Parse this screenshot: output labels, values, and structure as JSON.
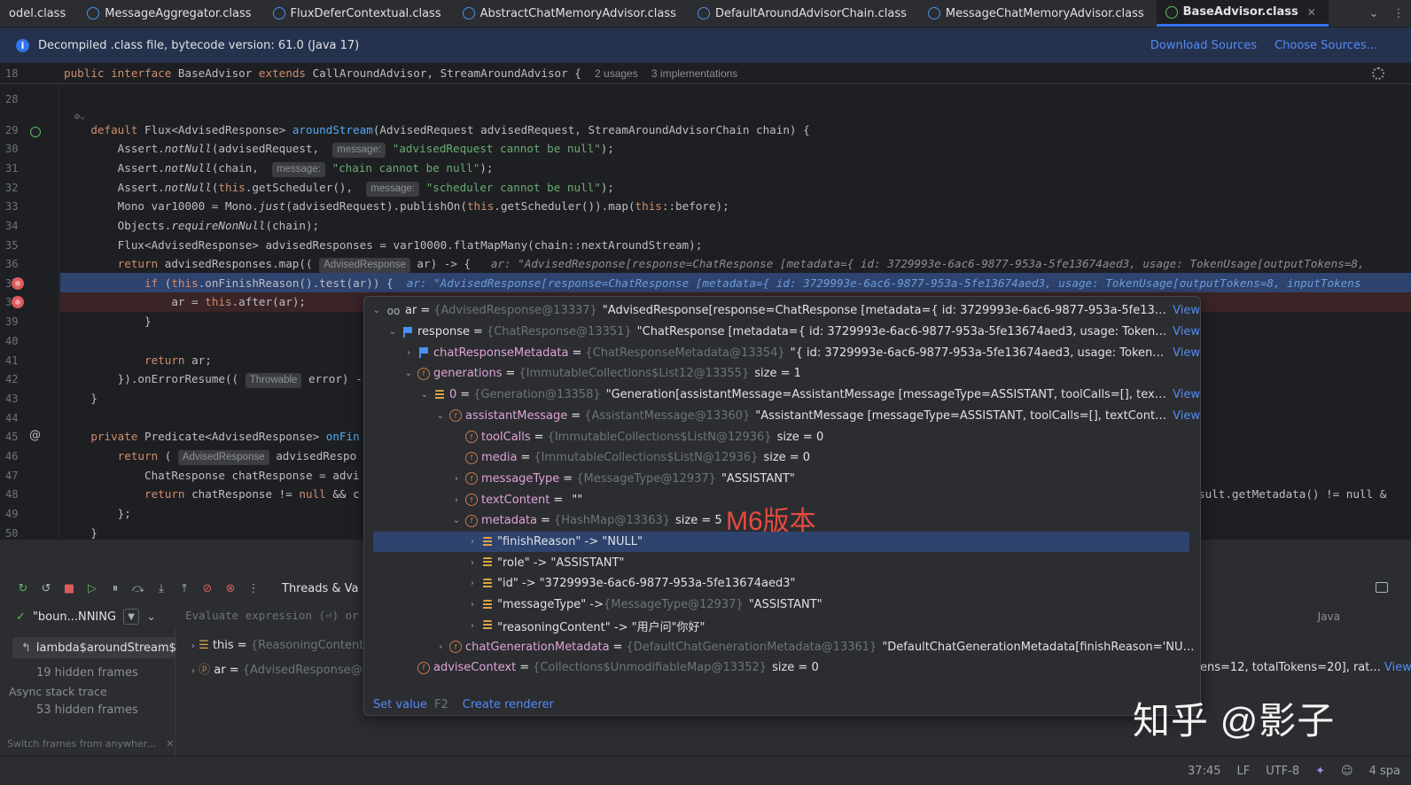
{
  "tabs": [
    {
      "label": "odel.class"
    },
    {
      "label": "MessageAggregator.class"
    },
    {
      "label": "FluxDeferContextual.class"
    },
    {
      "label": "AbstractChatMemoryAdvisor.class"
    },
    {
      "label": "DefaultAroundAdvisorChain.class"
    },
    {
      "label": "MessageChatMemoryAdvisor.class"
    },
    {
      "label": "BaseAdvisor.class",
      "active": true
    }
  ],
  "banner": {
    "text": "Decompiled .class file, bytecode version: 61.0 (Java 17)",
    "download": "Download Sources",
    "choose": "Choose Sources..."
  },
  "editor": {
    "sticky": {
      "line": "18",
      "usages": "2 usages",
      "impls": "3 implementations"
    },
    "line_numbers": [
      "28",
      "29",
      "30",
      "31",
      "32",
      "33",
      "34",
      "35",
      "36",
      "37",
      "38",
      "39",
      "40",
      "41",
      "42",
      "43",
      "44",
      "45",
      "46",
      "47",
      "48",
      "49",
      "50"
    ],
    "hint_message": "message:",
    "hint_advised": "AdvisedResponse",
    "hint_throwable": "Throwable",
    "str_advised_null": "\"advisedRequest cannot be null\"",
    "str_chain_null": "\"chain cannot be null\"",
    "str_scheduler_null": "\"scheduler cannot be null\"",
    "inline_ar_label": "ar:",
    "inline_ar_value": "\"AdvisedResponse[response=ChatResponse [metadata={ id: 3729993e-6ac6-9877-953a-5fe13674aed3, usage: TokenUsage[outputTokens=8, ",
    "inline_ar_value2": "\"AdvisedResponse[response=ChatResponse [metadata={ id: 3729993e-6ac6-9877-953a-5fe13674aed3, usage: TokenUsage[outputTokens=8, inputTokens",
    "line48_tail": "sult.getMetadata() != null &"
  },
  "debug": {
    "threads_tab": "Threads & Va",
    "thread": "\"boun...NNING",
    "eval_placeholder": "Evaluate expression (⏎) or",
    "language": "Java",
    "frame_selected": "lambda$aroundStream$0:",
    "hidden1": "19 hidden frames",
    "async": "Async stack trace",
    "hidden2": "53 hidden frames",
    "switch_frames": "Switch frames from anywher...",
    "var_this_name": "this",
    "var_this_cls": "{ReasoningContentA",
    "var_ar_name": "ar",
    "var_ar_cls": "{AdvisedResponse@13",
    "right_tail": "ens=12, totalTokens=20], rat...",
    "right_view": "View"
  },
  "popup": {
    "rows": [
      {
        "name": "ar",
        "cls": "{AdvisedResponse@13337}",
        "val": "\"AdvisedResponse[response=ChatResponse [metadata={ id: 3729993e-6ac6-9877-953a-5fe13674aed3, usa...",
        "view": "View"
      },
      {
        "name": "response",
        "cls": "{ChatResponse@13351}",
        "val": "\"ChatResponse [metadata={ id: 3729993e-6ac6-9877-953a-5fe13674aed3, usage: TokenUsage[outpu...",
        "view": "View"
      },
      {
        "name": "chatResponseMetadata",
        "cls": "{ChatResponseMetadata@13354}",
        "val": "\"{ id: 3729993e-6ac6-9877-953a-5fe13674aed3, usage: TokenUsage[outp...",
        "view": "View"
      },
      {
        "name": "generations",
        "cls": "{ImmutableCollections$List12@13355}",
        "val": "size = 1"
      },
      {
        "name": "0",
        "cls": "{Generation@13358}",
        "val": "\"Generation[assistantMessage=AssistantMessage [messageType=ASSISTANT, toolCalls=[], textContent=, m...",
        "view": "View"
      },
      {
        "name": "assistantMessage",
        "cls": "{AssistantMessage@13360}",
        "val": "\"AssistantMessage [messageType=ASSISTANT, toolCalls=[], textContent=, metad...",
        "view": "View"
      },
      {
        "name": "toolCalls",
        "cls": "{ImmutableCollections$ListN@12936}",
        "val": "size = 0"
      },
      {
        "name": "media",
        "cls": "{ImmutableCollections$ListN@12936}",
        "val": "size = 0"
      },
      {
        "name": "messageType",
        "cls": "{MessageType@12937}",
        "val": "\"ASSISTANT\""
      },
      {
        "name": "textContent",
        "cls": "",
        "val": "\"\""
      },
      {
        "name": "metadata",
        "cls": "{HashMap@13363}",
        "val": "size = 5"
      },
      {
        "name": "\"finishReason\" -> \"NULL\"",
        "cls": "",
        "val": ""
      },
      {
        "name": "\"role\" -> \"ASSISTANT\"",
        "cls": "",
        "val": ""
      },
      {
        "name": "\"id\" -> \"3729993e-6ac6-9877-953a-5fe13674aed3\"",
        "cls": "",
        "val": ""
      },
      {
        "name": "\"messageType\" -> ",
        "cls": "{MessageType@12937}",
        "val": "\"ASSISTANT\""
      },
      {
        "name": "\"reasoningContent\" -> \"用户问\"你好\"",
        "cls": "",
        "val": ""
      },
      {
        "name": "chatGenerationMetadata",
        "cls": "{DefaultChatGenerationMetadata@13361}",
        "val": "\"DefaultChatGenerationMetadata[finishReason='NULL', filters=0, me"
      },
      {
        "name": "adviseContext",
        "cls": "{Collections$UnmodifiableMap@13352}",
        "val": "size = 0"
      }
    ],
    "annotation": "M6版本",
    "set_value": "Set value",
    "f2": "F2",
    "create_renderer": "Create renderer"
  },
  "watermark": "知乎 @影子",
  "status": {
    "pos": "37:45",
    "lf": "LF",
    "enc": "UTF-8",
    "indent": "4 spa"
  }
}
